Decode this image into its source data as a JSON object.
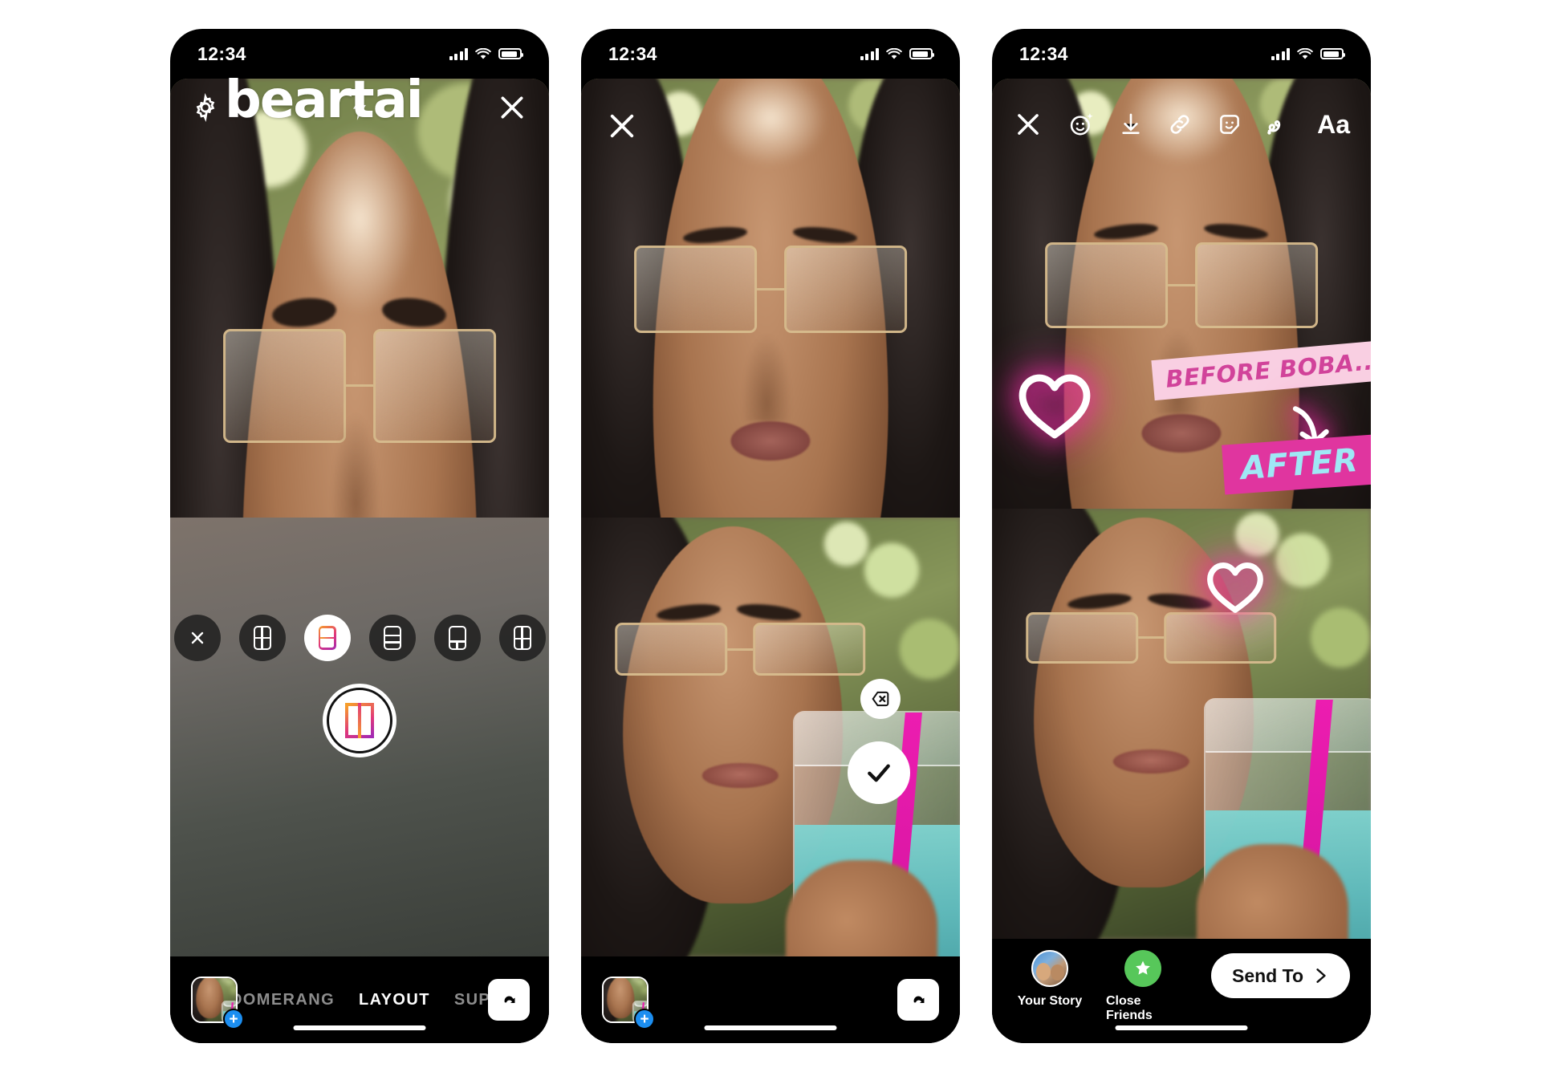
{
  "status_bar": {
    "time": "12:34",
    "signal": "cellular-bars-icon",
    "wifi": "wifi-icon",
    "battery": "battery-icon"
  },
  "phone1": {
    "watermark": "beartai",
    "top_controls": [
      {
        "name": "settings-gear-icon",
        "label": ""
      },
      {
        "name": "flash-icon",
        "label": ""
      },
      {
        "name": "close-icon",
        "label": ""
      }
    ],
    "layout_options": [
      {
        "name": "layout-off-option",
        "icon": "close-icon",
        "selected": false
      },
      {
        "name": "layout-2x2-option",
        "icon": "grid-2x2-icon",
        "selected": false
      },
      {
        "name": "layout-2-vertical-option",
        "icon": "grid-2-stacked-icon",
        "selected": true
      },
      {
        "name": "layout-3-horizontal-option",
        "icon": "grid-3-stacked-icon",
        "selected": false
      },
      {
        "name": "layout-1-top-2-bottom-option",
        "icon": "grid-1-top-2-bottom-icon",
        "selected": false
      },
      {
        "name": "layout-quad-option",
        "icon": "grid-quad-icon",
        "selected": false
      }
    ],
    "shutter": {
      "name": "shutter-button",
      "icon": "layout-gradient-icon"
    },
    "gallery_thumb": {
      "name": "gallery-thumbnail",
      "badge": "+"
    },
    "modes": [
      {
        "label": "BOOMERANG",
        "active": false
      },
      {
        "label": "LAYOUT",
        "active": true
      },
      {
        "label": "SUPERZOOM",
        "active": false
      }
    ],
    "flip_camera": "flip-camera-icon"
  },
  "phone2": {
    "close": "close-icon",
    "delete_last": "delete-shot-icon",
    "confirm": "checkmark-icon",
    "gallery_thumb": {
      "name": "gallery-thumbnail",
      "badge": "+"
    },
    "flip_camera": "flip-camera-icon"
  },
  "phone3": {
    "toolbar": [
      {
        "name": "close-icon",
        "label": ""
      },
      {
        "name": "effects-smiley-sparkle-icon",
        "label": ""
      },
      {
        "name": "download-icon",
        "label": ""
      },
      {
        "name": "link-icon",
        "label": ""
      },
      {
        "name": "sticker-icon",
        "label": ""
      },
      {
        "name": "draw-squiggle-icon",
        "label": ""
      },
      {
        "name": "text-tool-icon",
        "label": "Aa"
      }
    ],
    "stickers": [
      {
        "name": "neon-heart-sticker-top",
        "type": "heart"
      },
      {
        "name": "neon-heart-sticker-bottom",
        "type": "heart"
      },
      {
        "name": "before-text-sticker",
        "text": "BEFORE BOBA...",
        "bg": "#f9cfe2",
        "fg": "#d1439a"
      },
      {
        "name": "after-text-sticker",
        "text": "AFTER",
        "bg": "#e0359f",
        "fg": "#9fe8f5"
      },
      {
        "name": "neon-arrow-sticker",
        "type": "arrow"
      }
    ],
    "destinations": [
      {
        "name": "your-story-destination",
        "label": "Your Story",
        "icon": "avatar"
      },
      {
        "name": "close-friends-destination",
        "label": "Close Friends",
        "icon": "green-star"
      }
    ],
    "send_to": {
      "label": "Send To",
      "icon": "chevron-right-icon"
    }
  },
  "colors": {
    "accent_pink": "#e0359f",
    "neon_pink": "#ff2bb0",
    "close_friends_green": "#57c75a",
    "badge_blue": "#1c8ef0"
  }
}
